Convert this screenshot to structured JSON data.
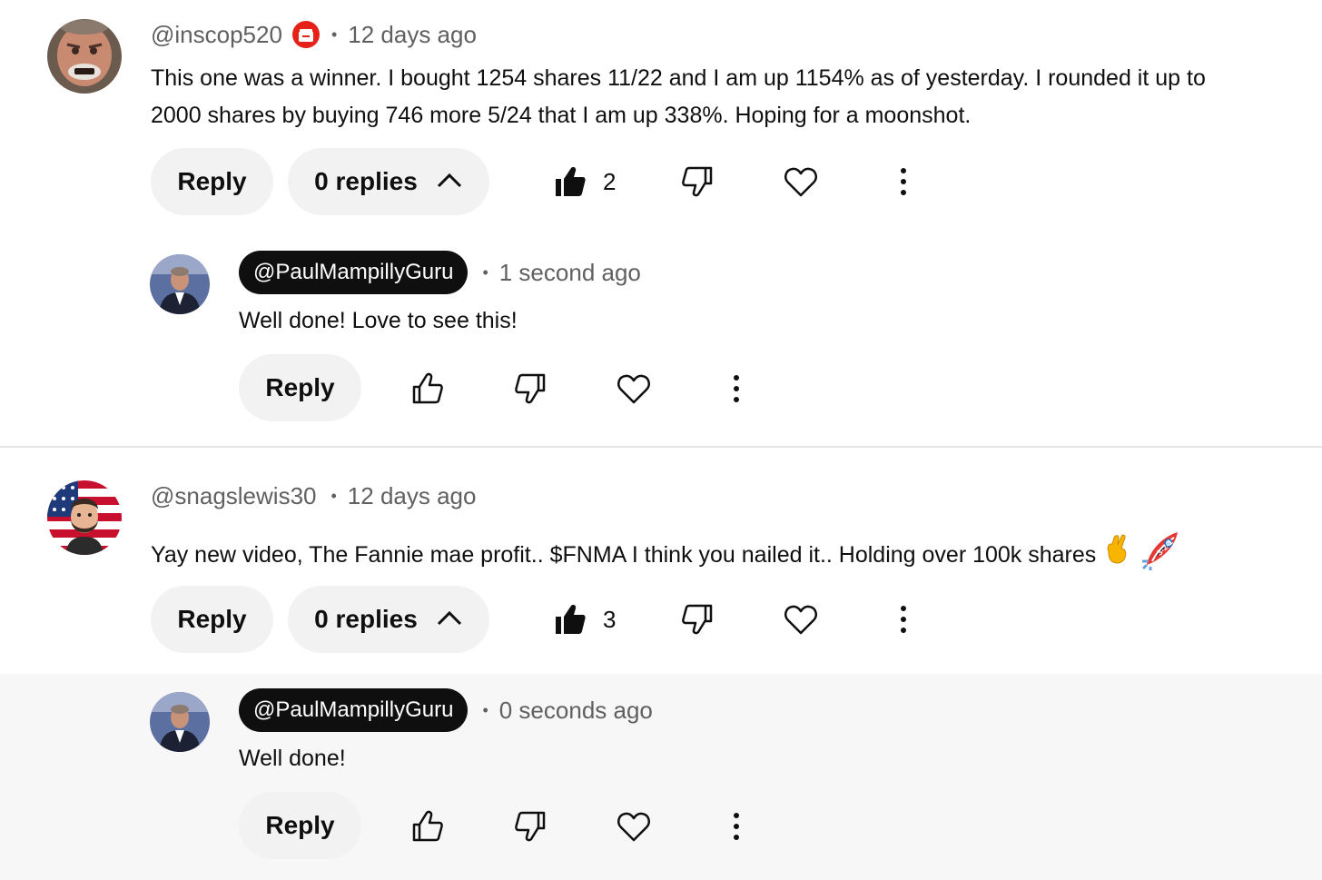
{
  "comments": [
    {
      "handle": "@inscop520",
      "member_badge_icon": "gift-member-icon",
      "time": "12 days ago",
      "text_line1": "This one was a winner. I bought 1254 shares  11/22 and I am up 1154% as of yesterday. I rounded it up to",
      "text_line2": "2000 shares by buying 746 more 5/24 that I am up 338%. Hoping for a moonshot.",
      "reply_label": "Reply",
      "replies_label": "0 replies",
      "like_count": "2",
      "reply": {
        "handle": "@PaulMampillyGuru",
        "time": "1 second ago",
        "text": "Well done! Love to see this!",
        "reply_label": "Reply"
      }
    },
    {
      "handle": "@snagslewis30",
      "time": "12 days ago",
      "text": "Yay new video, The Fannie mae profit.. $FNMA I think you nailed it.. Holding over 100k shares",
      "emojis": [
        "crossed-fingers-icon",
        "rocket-3-2-1-icon"
      ],
      "rocket_label": "3-2-1",
      "reply_label": "Reply",
      "replies_label": "0 replies",
      "like_count": "3",
      "reply": {
        "handle": "@PaulMampillyGuru",
        "time": "0 seconds ago",
        "text": "Well done!",
        "reply_label": "Reply"
      }
    }
  ],
  "colors": {
    "text": "#0f0f0f",
    "secondary": "#606060",
    "pill_bg": "#f2f2f2",
    "creator_badge_bg": "#0f0f0f",
    "member_badge": "#e62117",
    "highlight_bg": "#f7f7f7"
  }
}
